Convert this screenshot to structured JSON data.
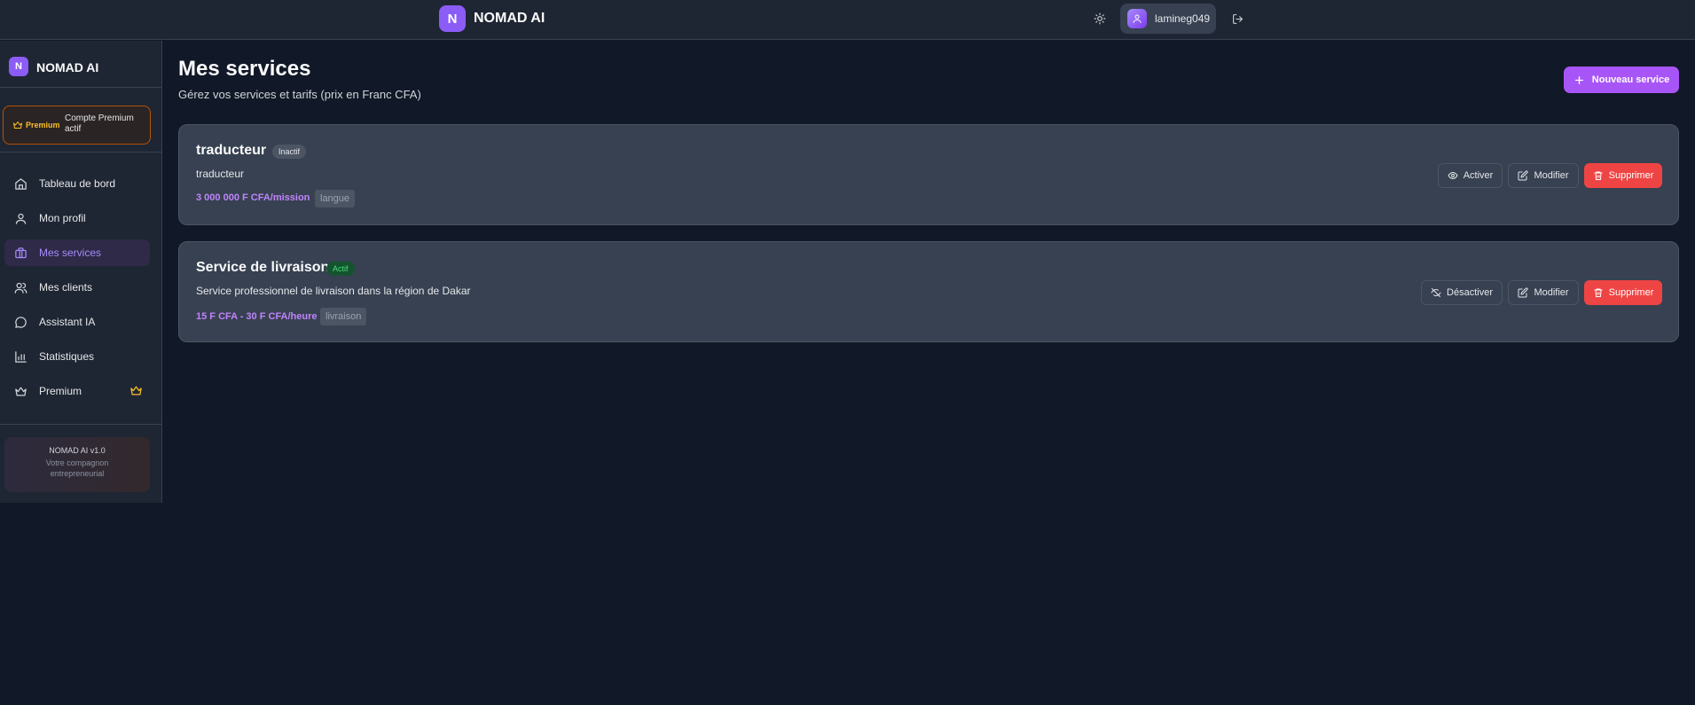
{
  "header": {
    "logo_letter": "N",
    "brand": "NOMAD AI",
    "username": "lamineg049"
  },
  "sidebar": {
    "logo_letter": "N",
    "brand": "NOMAD AI",
    "premium_badge": "Premium",
    "premium_status": "Compte Premium actif",
    "items": [
      {
        "label": "Tableau de bord",
        "icon": "home-icon"
      },
      {
        "label": "Mon profil",
        "icon": "user-icon"
      },
      {
        "label": "Mes services",
        "icon": "briefcase-icon",
        "active": true
      },
      {
        "label": "Mes clients",
        "icon": "users-icon"
      },
      {
        "label": "Assistant IA",
        "icon": "chat-icon"
      },
      {
        "label": "Statistiques",
        "icon": "bar-chart-icon"
      },
      {
        "label": "Premium",
        "icon": "crown-icon"
      }
    ],
    "version": "NOMAD AI v1.0",
    "tagline": "Votre compagnon entrepreneurial"
  },
  "main": {
    "title": "Mes services",
    "subtitle": "Gérez vos services et tarifs (prix en Franc CFA)",
    "new_button": "Nouveau service",
    "services": [
      {
        "name": "traducteur",
        "status": "Inactif",
        "description": "traducteur",
        "price": "3 000 000 F CFA/mission",
        "tag": "langue",
        "toggle_label": "Activer",
        "edit_label": "Modifier",
        "delete_label": "Supprimer"
      },
      {
        "name": "Service de livraison",
        "status": "Actif",
        "description": "Service professionnel de livraison dans la région de Dakar",
        "price": "15 F CFA - 30 F CFA/heure",
        "tag": "livraison",
        "toggle_label": "Désactiver",
        "edit_label": "Modifier",
        "delete_label": "Supprimer"
      }
    ]
  },
  "colors": {
    "accent": "#a855f7",
    "danger": "#ef4444",
    "premium": "#fbbf24",
    "background": "#111827"
  }
}
